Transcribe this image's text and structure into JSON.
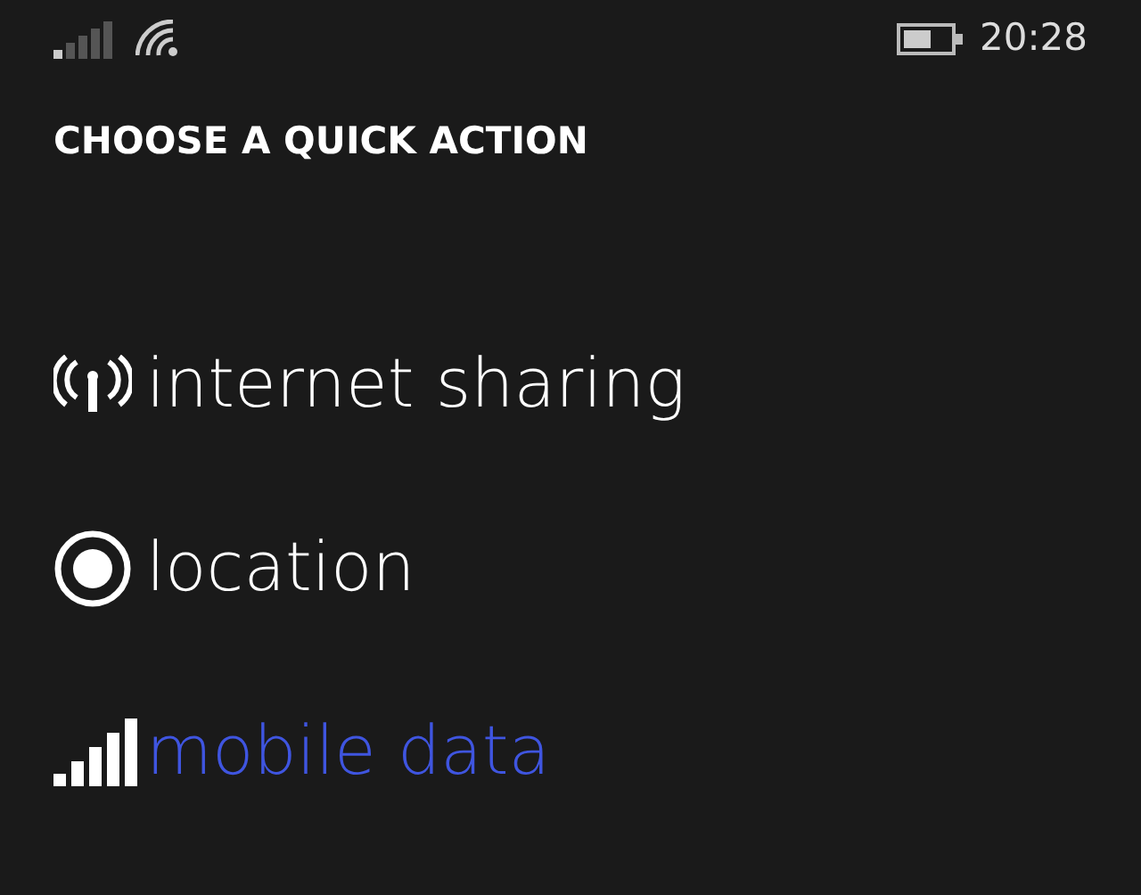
{
  "status_bar": {
    "time": "20:28"
  },
  "title": "CHOOSE A QUICK ACTION",
  "actions": [
    {
      "kind": "sharing",
      "label": "internet sharing",
      "selected": false
    },
    {
      "kind": "location",
      "label": "location",
      "selected": false
    },
    {
      "kind": "cellular",
      "label": "mobile data",
      "selected": true
    }
  ]
}
